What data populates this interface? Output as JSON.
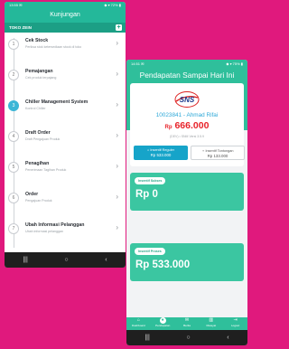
{
  "phone1": {
    "status_left": "13:55 ✉",
    "status_right": "◆ ▾ 72% ▮",
    "header_title": "Kunjungan",
    "store_name": "TOKO ZEIN",
    "plus": "+",
    "menu": [
      {
        "no": "1",
        "title": "Cek Stock",
        "sub": "Periksa stok ketersediaan stock di toko"
      },
      {
        "no": "2",
        "title": "Pemajangan",
        "sub": "Cek produk terpajang"
      },
      {
        "no": "3",
        "title": "Chiller Management System",
        "sub": "Kontrol Chiller"
      },
      {
        "no": "4",
        "title": "Draft Order",
        "sub": "Draft Pengajuan Produk"
      },
      {
        "no": "5",
        "title": "Penagihan",
        "sub": "Penerimaan Tagihan Produk"
      },
      {
        "no": "6",
        "title": "Order",
        "sub": "Pengajuan Produk"
      },
      {
        "no": "7",
        "title": "Ubah Informasi Pelanggan",
        "sub": "Ubah informasi pelanggan"
      }
    ],
    "chevron": "›",
    "nav": [
      "|||",
      "○",
      "‹"
    ]
  },
  "phone2": {
    "status_left": "14:51 ✉",
    "status_right": "◆ ▾ 75% ▮",
    "title": "Pendapatan Sampai Hari Ini",
    "logo_text": "SNS",
    "sales_id": "10023841 - Ahmad Rifai",
    "amount_prefix": "Rp",
    "amount": "666.000",
    "version": "(DEV) • SNM Versi 3.5.9",
    "btn_regular_label": "Insentif Reguler",
    "btn_regular_value": "Rp 533.000",
    "btn_tonton_label": "Insentif Tontongan",
    "btn_tonton_value": "Rp 133.000",
    "panel_sukses_label": "Insentif Sukses",
    "panel_sukses_value": "Rp 0",
    "panel_proses_label": "Insentif Proses",
    "panel_proses_value": "Rp 533.000",
    "bottom_nav": [
      {
        "icon": "⌂",
        "label": "Dashboard"
      },
      {
        "icon": "●",
        "label": "Pendapatan"
      },
      {
        "icon": "✉",
        "label": "Berita"
      },
      {
        "icon": "▥",
        "label": "Riwayat"
      },
      {
        "icon": "⇥",
        "label": "Logout"
      }
    ],
    "nav": [
      "|||",
      "○",
      "‹"
    ]
  },
  "colors": {
    "background": "#e0197d",
    "teal": "#24b89a",
    "red": "#e8232a",
    "blue": "#16a4c9"
  }
}
